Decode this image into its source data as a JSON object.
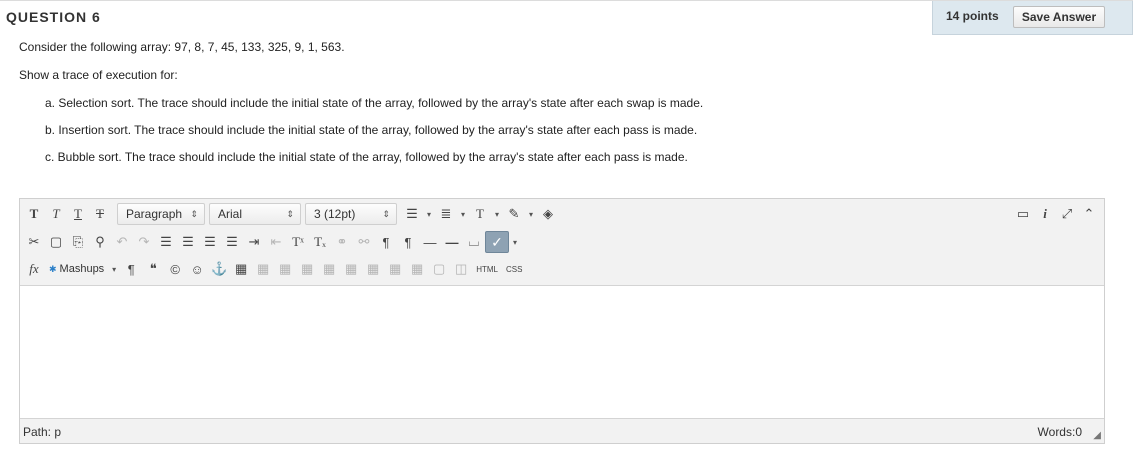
{
  "question": {
    "title": "QUESTION 6",
    "points": "14 points",
    "save_label": "Save Answer",
    "intro": "Consider the following array: 97, 8, 7, 45, 133, 325, 9, 1, 563.",
    "prompt": "Show a trace of execution for:",
    "parts": [
      "a. Selection sort. The trace should include the initial state of the array, followed by the array's state after each swap is made.",
      "b. Insertion sort. The trace should include the initial state of the array, followed by the array's state after each pass is made.",
      "c. Bubble sort. The trace should include the initial state of the array, followed by the array's state after each pass is made."
    ]
  },
  "editor": {
    "format_select": "Paragraph",
    "font_select": "Arial",
    "size_select": "3 (12pt)",
    "mashups_label": "Mashups",
    "html_label": "HTML",
    "css_label": "CSS",
    "path_label": "Path: p",
    "words_label": "Words:0"
  }
}
